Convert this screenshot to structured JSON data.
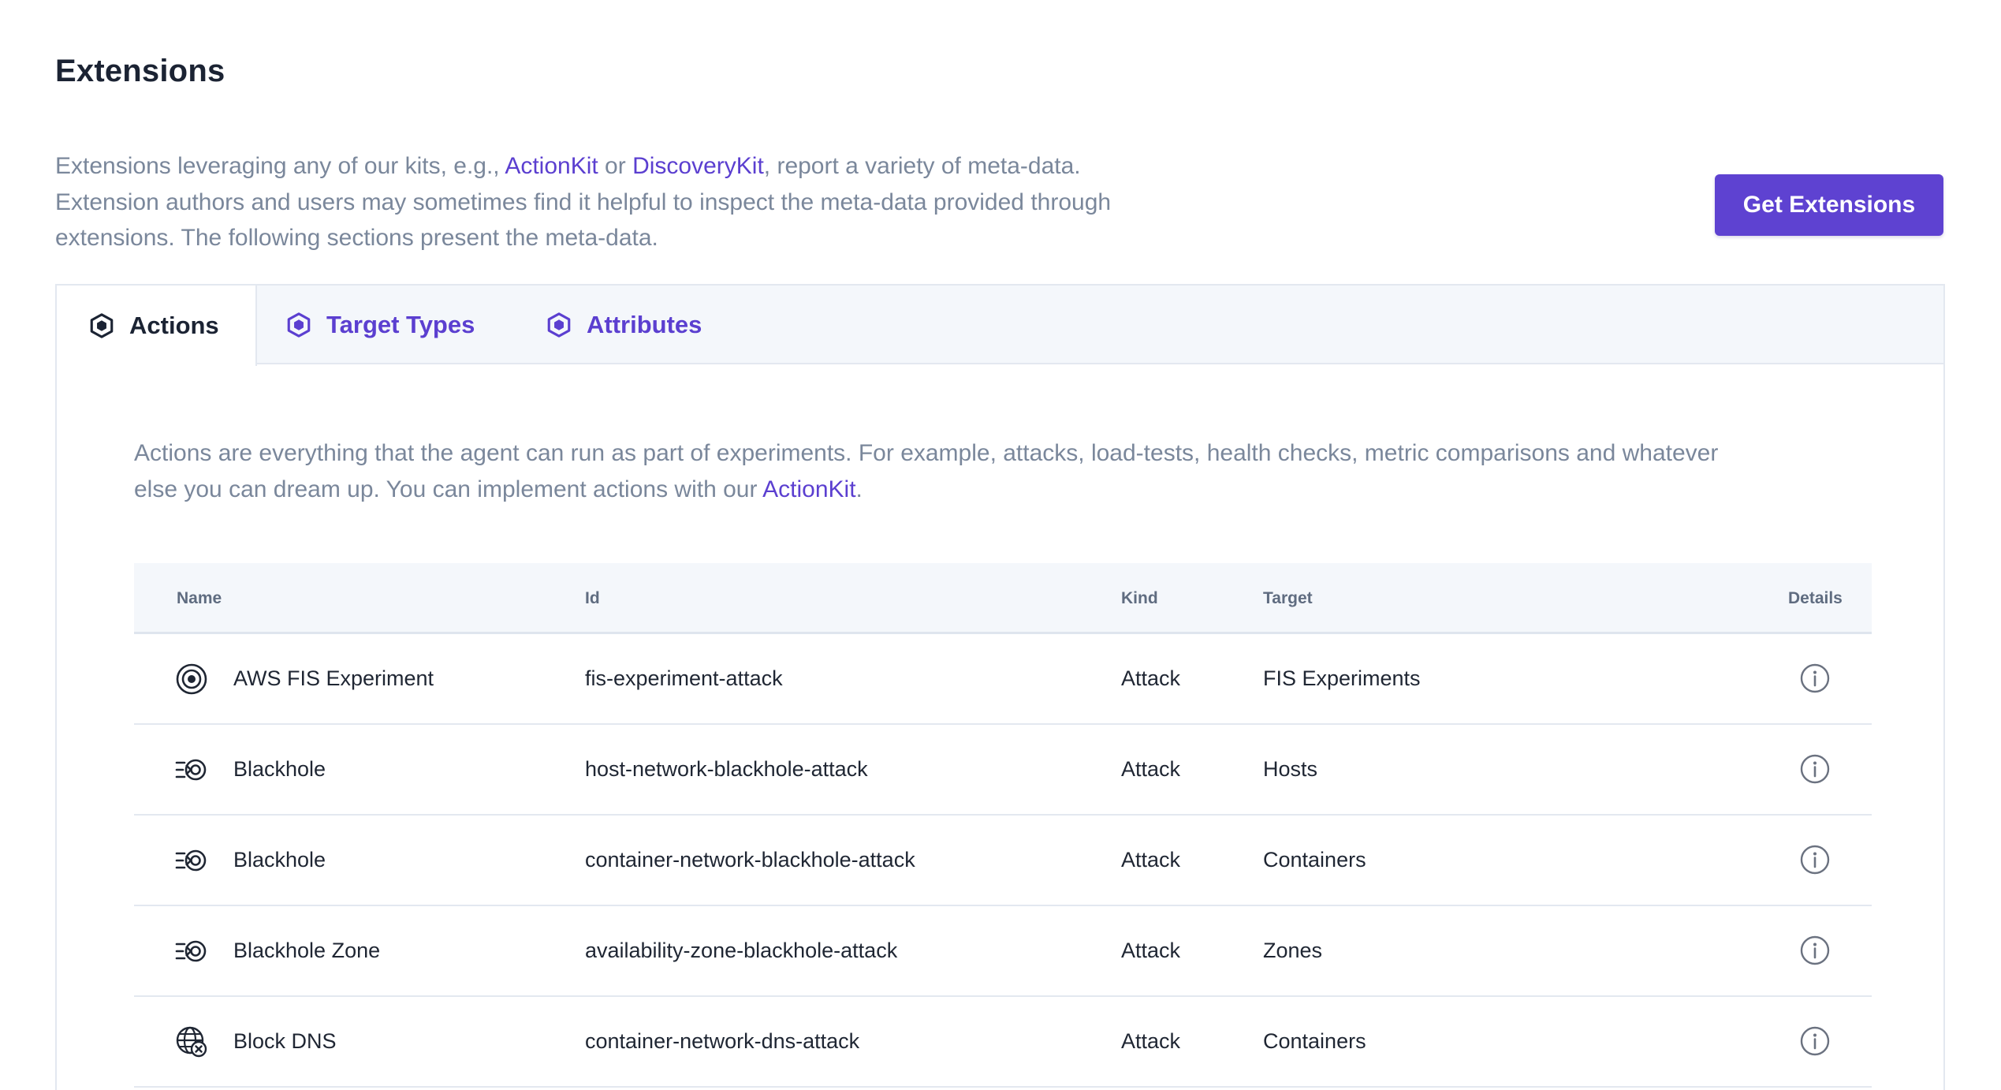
{
  "header": {
    "title": "Extensions",
    "intro_part1": "Extensions leveraging any of our kits, e.g., ",
    "intro_link1": "ActionKit",
    "intro_part2": " or ",
    "intro_link2": "DiscoveryKit",
    "intro_part3": ", report a variety of meta-data.",
    "intro_line2": "Extension authors and users may sometimes find it helpful to inspect the meta-data provided through",
    "intro_line3": "extensions. The following sections present the meta-data.",
    "get_extensions_label": "Get Extensions"
  },
  "tabs": [
    {
      "label": "Actions",
      "icon": "hexagon-icon",
      "active": true
    },
    {
      "label": "Target Types",
      "icon": "hexagon-icon",
      "active": false
    },
    {
      "label": "Attributes",
      "icon": "hexagon-icon",
      "active": false
    }
  ],
  "actions_panel": {
    "description_line1": "Actions are everything that the agent can run as part of experiments. For example, attacks, load-tests, health checks, metric comparisons and whatever",
    "description_line2_pre": "else you can dream up. You can implement actions with our ",
    "description_link": "ActionKit",
    "description_line2_post": "."
  },
  "table": {
    "columns": {
      "name": "Name",
      "id": "Id",
      "kind": "Kind",
      "target": "Target",
      "details": "Details"
    },
    "rows": [
      {
        "icon": "target-icon",
        "name": "AWS FIS Experiment",
        "id": "fis-experiment-attack",
        "kind": "Attack",
        "target": "FIS Experiments"
      },
      {
        "icon": "blackhole-icon",
        "name": "Blackhole",
        "id": "host-network-blackhole-attack",
        "kind": "Attack",
        "target": "Hosts"
      },
      {
        "icon": "blackhole-icon",
        "name": "Blackhole",
        "id": "container-network-blackhole-attack",
        "kind": "Attack",
        "target": "Containers"
      },
      {
        "icon": "blackhole-icon",
        "name": "Blackhole Zone",
        "id": "availability-zone-blackhole-attack",
        "kind": "Attack",
        "target": "Zones"
      },
      {
        "icon": "globe-block-icon",
        "name": "Block DNS",
        "id": "container-network-dns-attack",
        "kind": "Attack",
        "target": "Containers"
      }
    ]
  },
  "colors": {
    "accent": "#5e42d1",
    "link": "#5b3fd0",
    "muted_text": "#7a879b",
    "header_bg": "#f4f7fb"
  }
}
